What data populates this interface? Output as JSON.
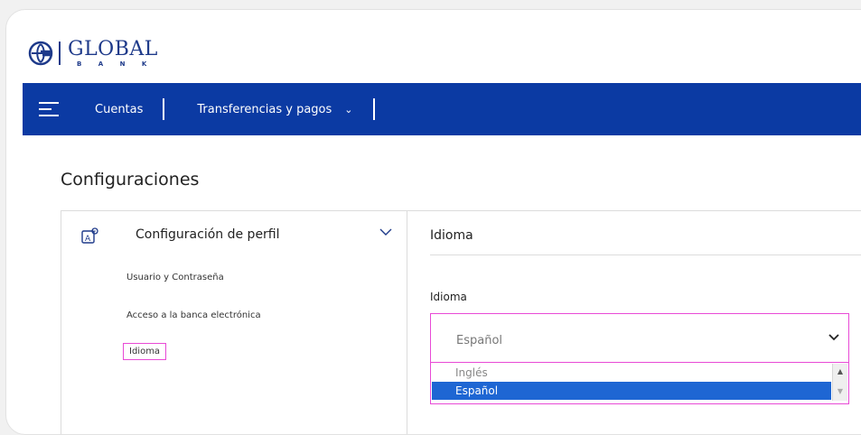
{
  "logo": {
    "name": "GLOBAL",
    "sub": "B A N K"
  },
  "navbar": {
    "items": [
      {
        "label": "Cuentas"
      },
      {
        "label": "Transferencias y pagos"
      }
    ]
  },
  "page": {
    "title": "Configuraciones"
  },
  "sidebar": {
    "section_title": "Configuración de perfil",
    "items": [
      {
        "label": "Usuario y Contraseña"
      },
      {
        "label": "Acceso a la banca electrónica"
      },
      {
        "label": "Idioma"
      }
    ]
  },
  "content": {
    "title": "Idioma",
    "field_label": "Idioma",
    "selected_value": "Español",
    "options": [
      "Inglés",
      "Español"
    ]
  },
  "colors": {
    "brand": "#0b3aa3",
    "highlight": "#e84ad6",
    "selected": "#1e66d3"
  }
}
